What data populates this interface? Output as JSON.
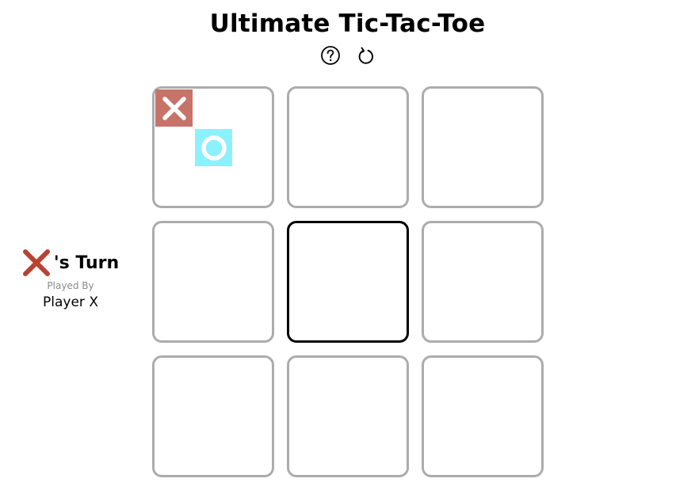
{
  "title": "Ultimate Tic-Tac-Toe",
  "toolbar": {
    "help_icon": "question-circle-icon",
    "restart_icon": "restart-arrow-icon"
  },
  "turn": {
    "symbol": "X",
    "text": "'s Turn",
    "played_by_label": "Played By",
    "player_name": "Player X",
    "color": "#b94232"
  },
  "board": {
    "active_board": 4,
    "small_boards": [
      {
        "cells": [
          "X",
          "",
          "",
          "",
          "O",
          "",
          "",
          "",
          ""
        ]
      },
      {
        "cells": [
          "",
          "",
          "",
          "",
          "",
          "",
          "",
          "",
          ""
        ]
      },
      {
        "cells": [
          "",
          "",
          "",
          "",
          "",
          "",
          "",
          "",
          ""
        ]
      },
      {
        "cells": [
          "",
          "",
          "",
          "",
          "",
          "",
          "",
          "",
          ""
        ]
      },
      {
        "cells": [
          "",
          "",
          "",
          "",
          "",
          "",
          "",
          "",
          ""
        ]
      },
      {
        "cells": [
          "",
          "",
          "",
          "",
          "",
          "",
          "",
          "",
          ""
        ]
      },
      {
        "cells": [
          "",
          "",
          "",
          "",
          "",
          "",
          "",
          "",
          ""
        ]
      },
      {
        "cells": [
          "",
          "",
          "",
          "",
          "",
          "",
          "",
          "",
          ""
        ]
      },
      {
        "cells": [
          "",
          "",
          "",
          "",
          "",
          "",
          "",
          "",
          ""
        ]
      }
    ],
    "colors": {
      "x_tile": "#c8736a",
      "o_tile": "#8cf1ff",
      "border": "#acacac",
      "active_border": "#000000"
    }
  }
}
